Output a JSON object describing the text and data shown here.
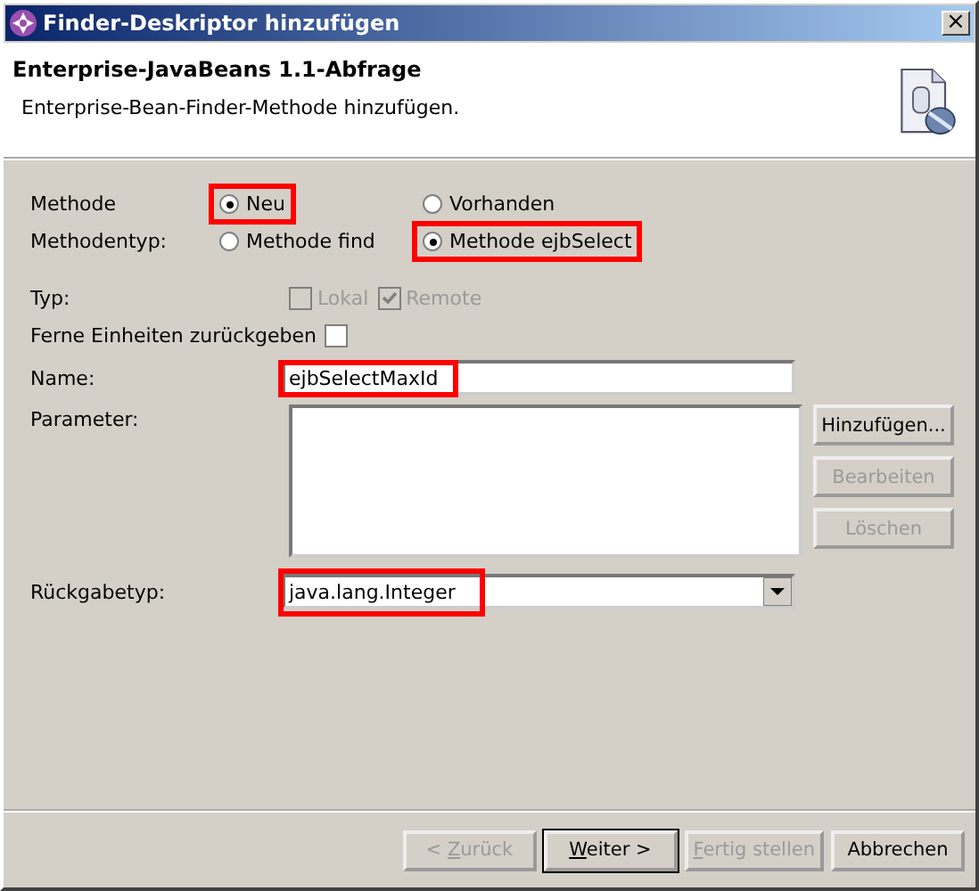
{
  "window": {
    "title": "Finder-Deskriptor hinzufügen",
    "close": "×"
  },
  "header": {
    "title": "Enterprise-JavaBeans 1.1-Abfrage",
    "description": "Enterprise-Bean-Finder-Methode hinzufügen."
  },
  "methode": {
    "label": "Methode",
    "options": [
      {
        "label": "Neu",
        "selected": true,
        "highlighted": true
      },
      {
        "label": "Vorhanden",
        "selected": false,
        "highlighted": false
      }
    ]
  },
  "methodentyp": {
    "label": "Methodentyp:",
    "options": [
      {
        "label": "Methode find",
        "selected": false,
        "highlighted": false
      },
      {
        "label": "Methode ejbSelect",
        "selected": true,
        "highlighted": true
      }
    ]
  },
  "typ": {
    "label": "Typ:",
    "options": [
      {
        "label": "Lokal",
        "checked": false,
        "disabled": true
      },
      {
        "label": "Remote",
        "checked": true,
        "disabled": true
      }
    ]
  },
  "ferne": {
    "label": "Ferne Einheiten zurückgeben",
    "checked": false
  },
  "name": {
    "label": "Name:",
    "value": "ejbSelectMaxId",
    "highlighted": true
  },
  "parameter": {
    "label": "Parameter:",
    "buttons": [
      {
        "label_parts": [
          {
            "text": "Hinzufügen...",
            "underlined": false
          }
        ],
        "disabled": false
      },
      {
        "label_parts": [
          {
            "text": "Bearbeiten",
            "underlined": false
          }
        ],
        "disabled": true
      },
      {
        "label_parts": [
          {
            "text": "Löschen",
            "underlined": false
          }
        ],
        "disabled": true
      }
    ]
  },
  "rueckgabetyp": {
    "label": "Rückgabetyp:",
    "value": "java.lang.Integer",
    "highlighted": true
  },
  "buttons": [
    {
      "label_parts": [
        {
          "text": "< ",
          "underlined": false
        },
        {
          "text": "Z",
          "underlined": true
        },
        {
          "text": "urück",
          "underlined": false
        }
      ],
      "disabled": true,
      "default": false
    },
    {
      "label_parts": [
        {
          "text": "W",
          "underlined": true
        },
        {
          "text": "eiter >",
          "underlined": false
        }
      ],
      "disabled": false,
      "default": true
    },
    {
      "label_parts": [
        {
          "text": "F",
          "underlined": true
        },
        {
          "text": "ertig stellen",
          "underlined": false
        }
      ],
      "disabled": true,
      "default": false
    },
    {
      "label_parts": [
        {
          "text": "Abbrechen",
          "underlined": false
        }
      ],
      "disabled": false,
      "default": false
    }
  ]
}
